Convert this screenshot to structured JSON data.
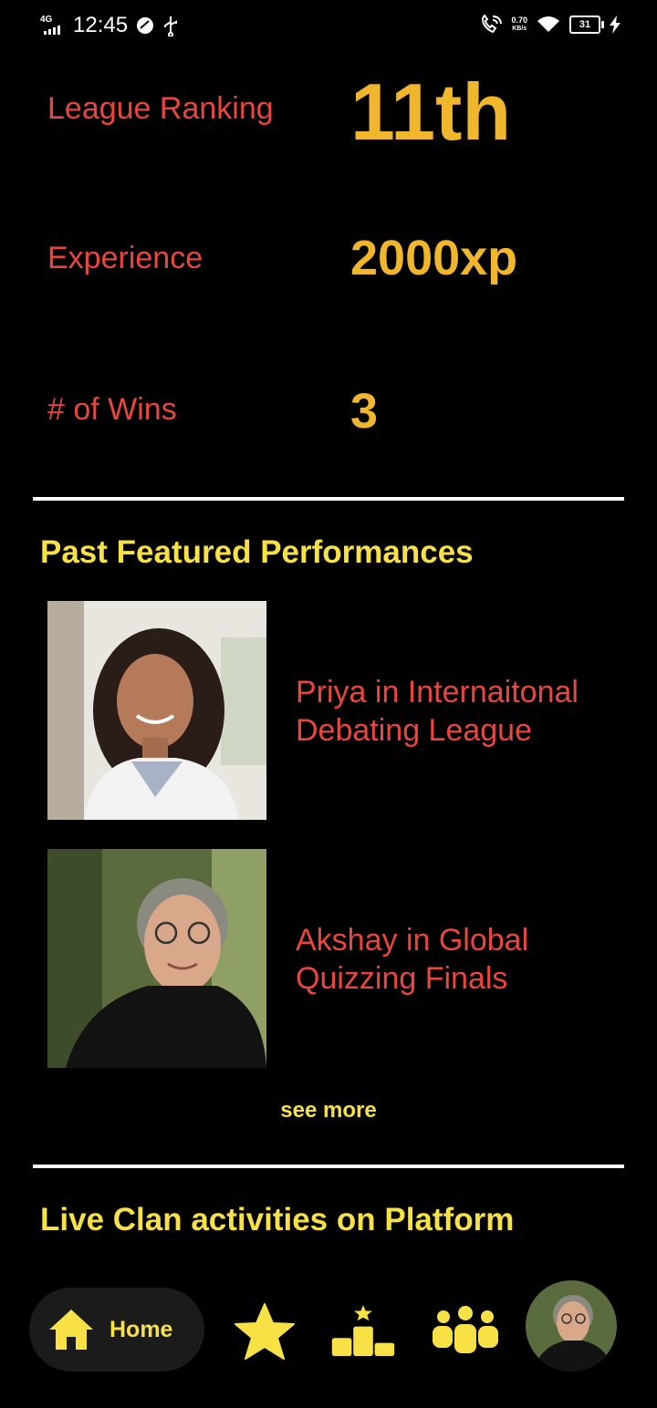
{
  "status_bar": {
    "network": "4G",
    "time": "12:45",
    "speed_value": "0.70",
    "speed_unit": "KB/s",
    "battery": "31"
  },
  "stats": {
    "ranking_label": "League Ranking",
    "ranking_value": "11th",
    "experience_label": "Experience",
    "experience_value": "2000xp",
    "wins_label": "# of Wins",
    "wins_value": "3"
  },
  "past_performances": {
    "title": "Past Featured Performances",
    "items": [
      {
        "caption_line1": "Priya in  Internaitonal",
        "caption_line2": "Debating League"
      },
      {
        "caption_line1": "Akshay in Global",
        "caption_line2": "Quizzing Finals"
      }
    ],
    "see_more": "see more"
  },
  "live_section": {
    "title": "Live Clan activities on Platform"
  },
  "bottom_nav": {
    "home_label": "Home",
    "icons": [
      "home-icon",
      "star-icon",
      "leaderboard-icon",
      "clan-icon",
      "profile-avatar"
    ]
  },
  "colors": {
    "background": "#000000",
    "label_red": "#e8463f",
    "value_gold": "#f0b72d",
    "title_yellow": "#f8e145",
    "nav_pill": "#1b1b1b"
  }
}
